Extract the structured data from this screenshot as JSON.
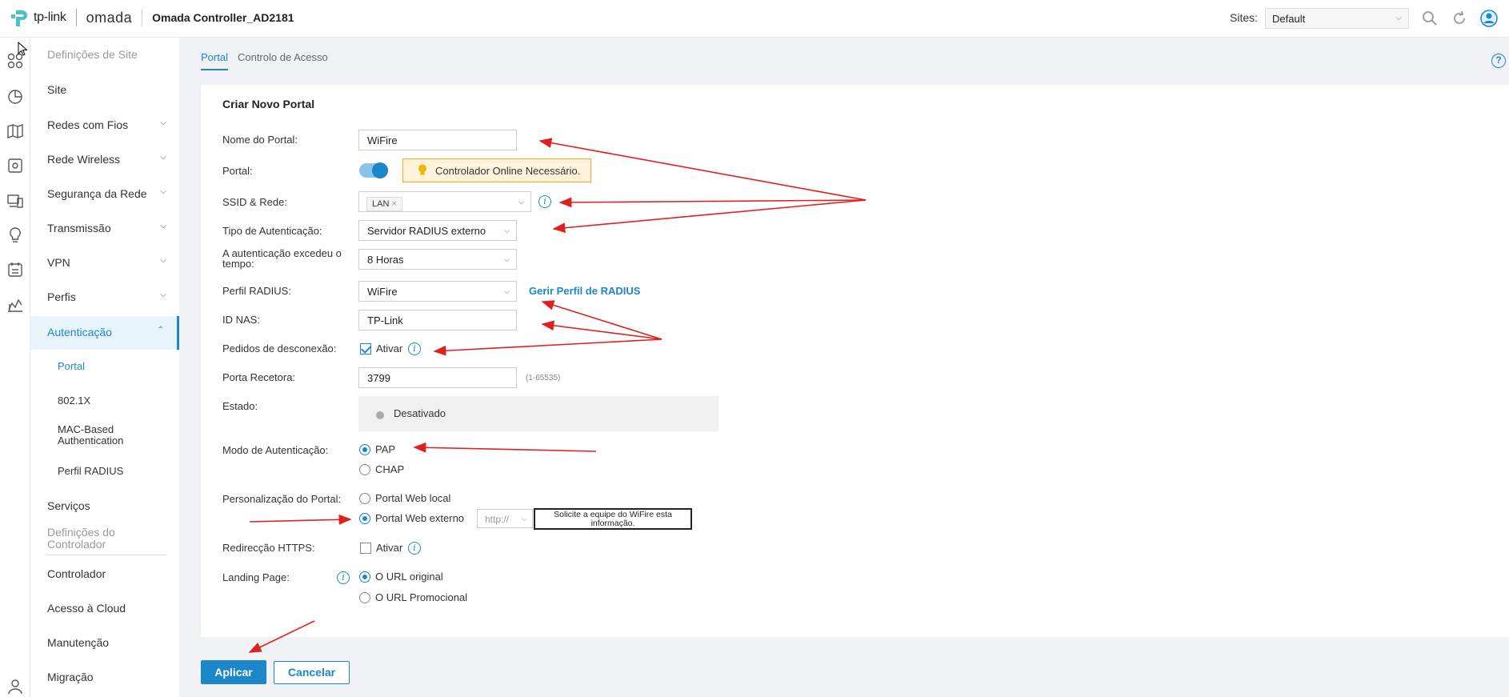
{
  "header": {
    "brand": "tp-link",
    "product": "omada",
    "controller_name": "Omada Controller_AD2181",
    "sites_label": "Sites:",
    "site_value": "Default"
  },
  "sidebar": {
    "section_site": "Definições de Site",
    "items": [
      {
        "label": "Site"
      },
      {
        "label": "Redes com Fios"
      },
      {
        "label": "Rede Wireless"
      },
      {
        "label": "Segurança da Rede"
      },
      {
        "label": "Transmissão"
      },
      {
        "label": "VPN"
      },
      {
        "label": "Perfis"
      },
      {
        "label": "Autenticação"
      }
    ],
    "sub_items": [
      {
        "label": "Portal"
      },
      {
        "label": "802.1X"
      },
      {
        "label": "MAC-Based Authentication"
      },
      {
        "label": "Perfil RADIUS"
      }
    ],
    "services": "Serviços",
    "section_controller": "Definições do Controlador",
    "controller_items": [
      {
        "label": "Controlador"
      },
      {
        "label": "Acesso à Cloud"
      },
      {
        "label": "Manutenção"
      },
      {
        "label": "Migração"
      }
    ]
  },
  "tabs": [
    {
      "label": "Portal"
    },
    {
      "label": "Controlo de Acesso"
    }
  ],
  "form": {
    "title": "Criar Novo Portal",
    "portal_name_label": "Nome do Portal:",
    "portal_name_value": "WiFire",
    "portal_label": "Portal:",
    "portal_enabled": true,
    "notice": "Controlador Online Necessário.",
    "ssid_label": "SSID & Rede:",
    "ssid_tag": "LAN",
    "auth_type_label": "Tipo de Autenticação:",
    "auth_type_value": "Servidor RADIUS externo",
    "timeout_label": "A autenticação excedeu o tempo:",
    "timeout_value": "8 Horas",
    "radius_profile_label": "Perfil RADIUS:",
    "radius_profile_value": "WiFire",
    "radius_manage_link": "Gerir Perfil de RADIUS",
    "nas_id_label": "ID NAS:",
    "nas_id_value": "TP-Link",
    "disconnect_label": "Pedidos de desconexão:",
    "disconnect_option": "Ativar",
    "receiver_port_label": "Porta Recetora:",
    "receiver_port_value": "3799",
    "receiver_port_hint": "(1-65535)",
    "state_label": "Estado:",
    "state_value": "Desativado",
    "auth_mode_label": "Modo de Autenticação:",
    "auth_mode_options": [
      {
        "label": "PAP"
      },
      {
        "label": "CHAP"
      }
    ],
    "customization_label": "Personalização do Portal:",
    "customization_options": [
      {
        "label": "Portal Web local"
      },
      {
        "label": "Portal Web externo"
      }
    ],
    "protocol_value": "http://",
    "callout_text": "Solicite a equipe do WiFire esta informação.",
    "https_redirect_label": "Redirecção HTTPS:",
    "https_redirect_option": "Ativar",
    "landing_page_label": "Landing Page:",
    "landing_options": [
      {
        "label": "O URL original"
      },
      {
        "label": "O URL Promocional"
      }
    ]
  },
  "actions": {
    "apply": "Aplicar",
    "cancel": "Cancelar"
  },
  "colors": {
    "accent": "#1b87c9",
    "annotation": "#e0201e",
    "notice_border": "#f5a623"
  }
}
